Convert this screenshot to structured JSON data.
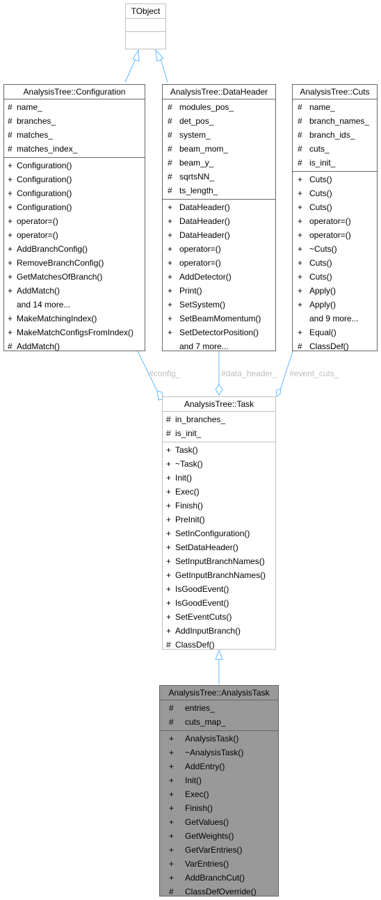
{
  "diagram": {
    "type": "class-collaboration-diagram",
    "edge_color": "#63b8ff",
    "classes": {
      "tobject": {
        "name": "TObject",
        "attributes": [],
        "methods": []
      },
      "configuration": {
        "name": "AnalysisTree::Configuration",
        "attributes": [
          {
            "vis": "#",
            "name": "name_"
          },
          {
            "vis": "#",
            "name": "branches_"
          },
          {
            "vis": "#",
            "name": "matches_"
          },
          {
            "vis": "#",
            "name": "matches_index_"
          }
        ],
        "methods": [
          {
            "vis": "+",
            "name": "Configuration()"
          },
          {
            "vis": "+",
            "name": "Configuration()"
          },
          {
            "vis": "+",
            "name": "Configuration()"
          },
          {
            "vis": "+",
            "name": "Configuration()"
          },
          {
            "vis": "+",
            "name": "operator=()"
          },
          {
            "vis": "+",
            "name": "operator=()"
          },
          {
            "vis": "+",
            "name": "AddBranchConfig()"
          },
          {
            "vis": "+",
            "name": "RemoveBranchConfig()"
          },
          {
            "vis": "+",
            "name": "GetMatchesOfBranch()"
          },
          {
            "vis": "+",
            "name": "AddMatch()"
          },
          {
            "vis": "",
            "name": "and 14 more..."
          },
          {
            "vis": "+",
            "name": "MakeMatchingIndex()"
          },
          {
            "vis": "+",
            "name": "MakeMatchConfigsFromIndex()"
          },
          {
            "vis": "#",
            "name": "AddMatch()"
          }
        ]
      },
      "dataheader": {
        "name": "AnalysisTree::DataHeader",
        "attributes": [
          {
            "vis": "#",
            "name": "modules_pos_"
          },
          {
            "vis": "#",
            "name": "det_pos_"
          },
          {
            "vis": "#",
            "name": "system_"
          },
          {
            "vis": "#",
            "name": "beam_mom_"
          },
          {
            "vis": "#",
            "name": "beam_y_"
          },
          {
            "vis": "#",
            "name": "sqrtsNN_"
          },
          {
            "vis": "#",
            "name": "ts_length_"
          }
        ],
        "methods": [
          {
            "vis": "+",
            "name": "DataHeader()"
          },
          {
            "vis": "+",
            "name": "DataHeader()"
          },
          {
            "vis": "+",
            "name": "DataHeader()"
          },
          {
            "vis": "+",
            "name": "operator=()"
          },
          {
            "vis": "+",
            "name": "operator=()"
          },
          {
            "vis": "+",
            "name": "AddDetector()"
          },
          {
            "vis": "+",
            "name": "Print()"
          },
          {
            "vis": "+",
            "name": "SetSystem()"
          },
          {
            "vis": "+",
            "name": "SetBeamMomentum()"
          },
          {
            "vis": "+",
            "name": "SetDetectorPosition()"
          },
          {
            "vis": "",
            "name": "and 7 more..."
          }
        ]
      },
      "cuts": {
        "name": "AnalysisTree::Cuts",
        "attributes": [
          {
            "vis": "#",
            "name": "name_"
          },
          {
            "vis": "#",
            "name": "branch_names_"
          },
          {
            "vis": "#",
            "name": "branch_ids_"
          },
          {
            "vis": "#",
            "name": "cuts_"
          },
          {
            "vis": "#",
            "name": "is_init_"
          }
        ],
        "methods": [
          {
            "vis": "+",
            "name": "Cuts()"
          },
          {
            "vis": "+",
            "name": "Cuts()"
          },
          {
            "vis": "+",
            "name": "Cuts()"
          },
          {
            "vis": "+",
            "name": "operator=()"
          },
          {
            "vis": "+",
            "name": "operator=()"
          },
          {
            "vis": "+",
            "name": "~Cuts()"
          },
          {
            "vis": "+",
            "name": "Cuts()"
          },
          {
            "vis": "+",
            "name": "Cuts()"
          },
          {
            "vis": "+",
            "name": "Apply()"
          },
          {
            "vis": "+",
            "name": "Apply()"
          },
          {
            "vis": "",
            "name": "and 9 more..."
          },
          {
            "vis": "+",
            "name": "Equal()"
          },
          {
            "vis": "#",
            "name": "ClassDef()"
          }
        ]
      },
      "task": {
        "name": "AnalysisTree::Task",
        "attributes": [
          {
            "vis": "#",
            "name": "in_branches_"
          },
          {
            "vis": "#",
            "name": "is_init_"
          }
        ],
        "methods": [
          {
            "vis": "+",
            "name": "Task()"
          },
          {
            "vis": "+",
            "name": "~Task()"
          },
          {
            "vis": "+",
            "name": "Init()"
          },
          {
            "vis": "+",
            "name": "Exec()"
          },
          {
            "vis": "+",
            "name": "Finish()"
          },
          {
            "vis": "+",
            "name": "PreInit()"
          },
          {
            "vis": "+",
            "name": "SetInConfiguration()"
          },
          {
            "vis": "+",
            "name": "SetDataHeader()"
          },
          {
            "vis": "+",
            "name": "SetInputBranchNames()"
          },
          {
            "vis": "+",
            "name": "GetInputBranchNames()"
          },
          {
            "vis": "+",
            "name": "IsGoodEvent()"
          },
          {
            "vis": "+",
            "name": "IsGoodEvent()"
          },
          {
            "vis": "+",
            "name": "SetEventCuts()"
          },
          {
            "vis": "+",
            "name": "AddInputBranch()"
          },
          {
            "vis": "#",
            "name": "ClassDef()"
          }
        ]
      },
      "analysistask": {
        "name": "AnalysisTree::AnalysisTask",
        "attributes": [
          {
            "vis": "#",
            "name": "entries_"
          },
          {
            "vis": "#",
            "name": "cuts_map_"
          }
        ],
        "methods": [
          {
            "vis": "+",
            "name": "AnalysisTask()"
          },
          {
            "vis": "+",
            "name": "~AnalysisTask()"
          },
          {
            "vis": "+",
            "name": "AddEntry()"
          },
          {
            "vis": "+",
            "name": "Init()"
          },
          {
            "vis": "+",
            "name": "Exec()"
          },
          {
            "vis": "+",
            "name": "Finish()"
          },
          {
            "vis": "+",
            "name": "GetValues()"
          },
          {
            "vis": "+",
            "name": "GetWeights()"
          },
          {
            "vis": "+",
            "name": "GetVarEntries()"
          },
          {
            "vis": "+",
            "name": "VarEntries()"
          },
          {
            "vis": "+",
            "name": "AddBranchCut()"
          },
          {
            "vis": "#",
            "name": "ClassDefOverride()"
          }
        ]
      }
    },
    "edges": [
      {
        "from": "configuration",
        "to": "tobject",
        "kind": "inheritance",
        "label": ""
      },
      {
        "from": "dataheader",
        "to": "tobject",
        "kind": "inheritance",
        "label": ""
      },
      {
        "from": "configuration",
        "to": "task",
        "kind": "aggregation",
        "label": "#config_"
      },
      {
        "from": "dataheader",
        "to": "task",
        "kind": "aggregation",
        "label": "#data_header_"
      },
      {
        "from": "cuts",
        "to": "task",
        "kind": "aggregation",
        "label": "#event_cuts_"
      },
      {
        "from": "analysistask",
        "to": "task",
        "kind": "inheritance",
        "label": ""
      }
    ]
  }
}
